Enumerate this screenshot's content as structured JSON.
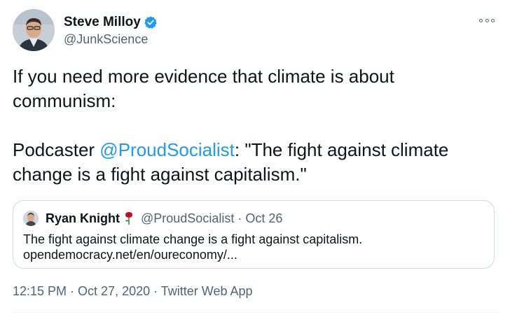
{
  "author": {
    "name": "Steve Milloy",
    "handle": "@JunkScience",
    "verified_color": "#1d9bf0"
  },
  "tweet": {
    "line1": "If you need more evidence that climate is about",
    "line2": "communism:",
    "line3_prefix": "Podcaster ",
    "line3_mention": "@ProudSocialist",
    "line3_suffix": ": \"The fight against climate",
    "line4": "change is a fight against capitalism.\""
  },
  "quote": {
    "name": "Ryan Knight",
    "emoji_icon": "rose-icon",
    "meta": "@ProudSocialist · Oct 26",
    "body_line1": "The fight against climate change is a fight against capitalism.",
    "body_line2": "opendemocracy.net/en/oureconomy/..."
  },
  "footer": {
    "timestamp": "12:15 PM · Oct 27, 2020 · Twitter Web App"
  },
  "icons": {
    "more": "more-options-icon",
    "verified": "verified-badge-icon"
  },
  "colors": {
    "text": "#0f1419",
    "secondary": "#536471",
    "link": "#1d9bf0",
    "border": "#cfd9de"
  }
}
